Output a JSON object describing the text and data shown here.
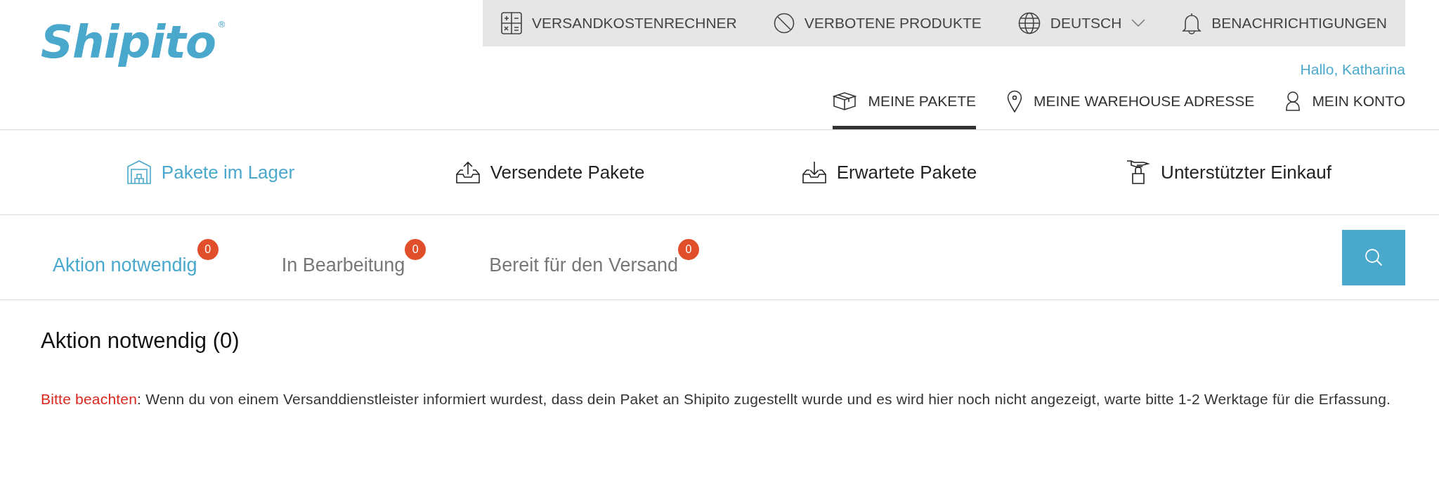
{
  "logo": {
    "text": "Shipito",
    "mark": "®"
  },
  "utility_nav": [
    {
      "label": "VERSANDKOSTENRECHNER",
      "dropdown": false
    },
    {
      "label": "VERBOTENE PRODUKTE",
      "dropdown": false
    },
    {
      "label": "DEUTSCH",
      "dropdown": true
    },
    {
      "label": "BENACHRICHTIGUNGEN",
      "dropdown": false
    }
  ],
  "greeting": "Hallo, Katharina",
  "main_nav": [
    {
      "label": "MEINE PAKETE",
      "selected": true
    },
    {
      "label": "MEINE WAREHOUSE ADRESSE",
      "selected": false
    },
    {
      "label": "MEIN KONTO",
      "selected": false
    }
  ],
  "section_tabs": [
    {
      "label": "Pakete im Lager",
      "selected": true
    },
    {
      "label": "Versendete Pakete",
      "selected": false
    },
    {
      "label": "Erwartete Pakete",
      "selected": false
    },
    {
      "label": "Unterstützter Einkauf",
      "selected": false
    }
  ],
  "status_tabs": [
    {
      "label": "Aktion notwendig",
      "count": "0",
      "selected": true
    },
    {
      "label": "In Bearbeitung",
      "count": "0",
      "selected": false
    },
    {
      "label": "Bereit für den Versand",
      "count": "0",
      "selected": false
    }
  ],
  "heading": "Aktion notwendig (0)",
  "note": {
    "label": "Bitte beachten",
    "text": ": Wenn du von einem Versanddienstleister informiert wurdest, dass dein Paket an Shipito zugestellt wurde und es wird hier noch nicht angezeigt, warte bitte 1-2 Werktage für die Erfassung."
  }
}
